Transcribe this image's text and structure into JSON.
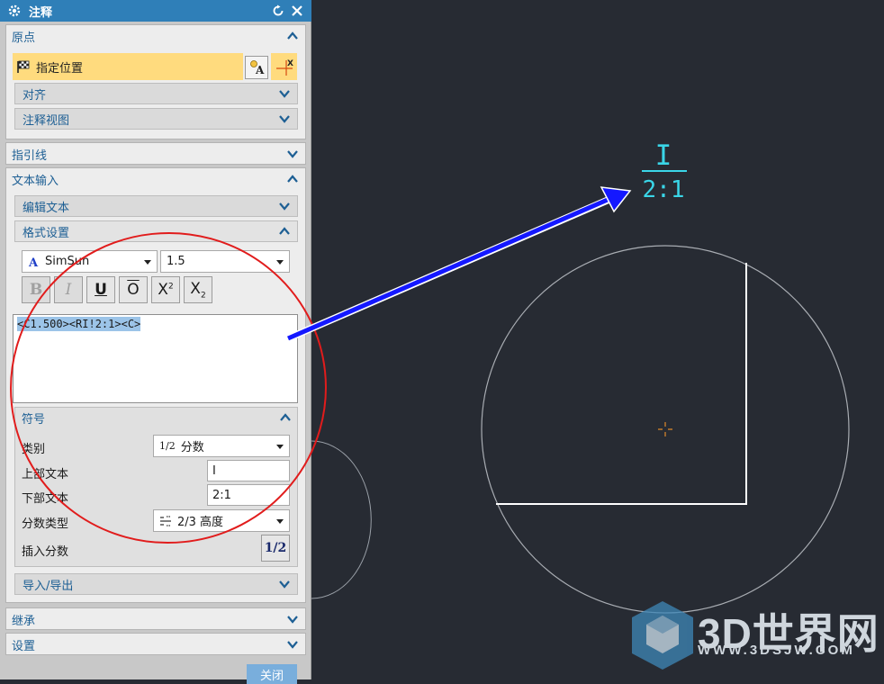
{
  "dialog": {
    "title": "注释",
    "reset_icon": "reset-icon",
    "close_icon": "close-icon"
  },
  "origin": {
    "header": "原点",
    "specify_location": "指定位置",
    "align": "对齐",
    "annotation_view": "注释视图"
  },
  "leader": {
    "header": "指引线"
  },
  "text_input": {
    "header": "文本输入",
    "edit_text": "编辑文本",
    "format_settings": "格式设置",
    "font": "SimSun",
    "font_size": "1.5",
    "format_buttons": [
      "B",
      "I",
      "U",
      "O",
      "X",
      "2",
      "X",
      "2"
    ],
    "content": "<C1.500><RI!2:1><C>"
  },
  "symbol": {
    "header": "符号",
    "category_label": "类别",
    "category_value": "分数",
    "category_icon_text": "1/2",
    "upper_text_label": "上部文本",
    "upper_text_value": "I",
    "lower_text_label": "下部文本",
    "lower_text_value": "2:1",
    "fraction_type_label": "分数类型",
    "fraction_type_value": "2/3 高度",
    "insert_fraction_label": "插入分数",
    "insert_fraction_button": "1/2"
  },
  "import_export": {
    "header": "导入/导出"
  },
  "inherit": {
    "header": "继承"
  },
  "settings": {
    "header": "设置"
  },
  "close_button": "关闭",
  "annotation": {
    "numerator": "I",
    "denominator": "2:1",
    "color": "#3ad6e8"
  },
  "watermark": {
    "brand": "3D世界网",
    "url": "WWW.3DSJW.COM"
  },
  "colors": {
    "title_bar": "#2f7fb8",
    "highlight": "#ffdb7e",
    "canvas_bg": "#272b33",
    "arrow": "#1418ff",
    "callout_circle": "#e11c1c",
    "section_label": "#1d5f94"
  }
}
